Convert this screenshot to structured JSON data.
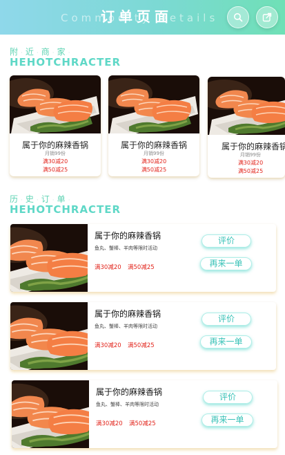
{
  "header": {
    "title": "订单页面",
    "subtitle": "Commodity Details",
    "search_icon": "search-icon",
    "share_icon": "share-icon",
    "accent": "#7cd9d4"
  },
  "nearby": {
    "title_chars": [
      "附",
      "近",
      "商",
      "家"
    ],
    "subtitle": "HEHOTCHRACTER",
    "items": [
      {
        "name": "属于你的麻辣香锅",
        "sales": "月销99份",
        "promo1": "满30减20",
        "promo2": "满50减25"
      },
      {
        "name": "属于你的麻辣香锅",
        "sales": "月销99份",
        "promo1": "满30减20",
        "promo2": "满50减25"
      },
      {
        "name": "属于你的麻辣香锅",
        "sales": "月销99份",
        "promo1": "满30减20",
        "promo2": "满50减25"
      }
    ]
  },
  "history": {
    "title_chars": [
      "历",
      "史",
      "订",
      "单"
    ],
    "subtitle": "HEHOTCHRACTER",
    "orders": [
      {
        "name": "属于你的麻辣香锅",
        "desc": "鱼丸、蟹棒、羊肉等限时活动",
        "promo1": "满30减20",
        "promo2": "满50减25",
        "review_label": "评价",
        "reorder_label": "再来一单"
      },
      {
        "name": "属于你的麻辣香锅",
        "desc": "鱼丸、蟹棒、羊肉等限时活动",
        "promo1": "满30减20",
        "promo2": "满50减25",
        "review_label": "评价",
        "reorder_label": "再来一单"
      },
      {
        "name": "属于你的麻辣香锅",
        "desc": "鱼丸、蟹棒、羊肉等限时活动",
        "promo1": "满30减20",
        "promo2": "满50减25",
        "review_label": "评价",
        "reorder_label": "再来一单"
      }
    ]
  },
  "colors": {
    "promo": "#e2231a",
    "button_text": "#38c2b7",
    "section": "#5fd3b3"
  }
}
